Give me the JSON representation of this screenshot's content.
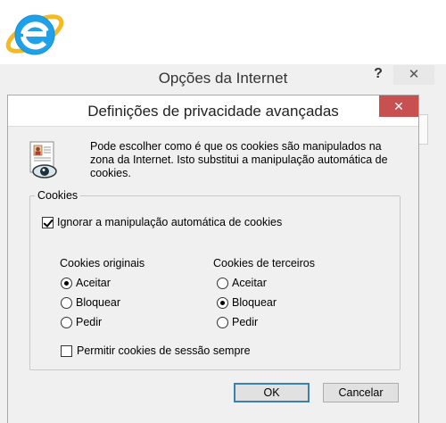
{
  "back_window": {
    "title": "Opções da Internet",
    "help_label": "?",
    "close_label": "✕"
  },
  "dialog": {
    "title": "Definições de privacidade avançadas",
    "close_label": "✕",
    "description": "Pode escolher como é que os cookies são manipulados na zona da Internet. Isto substitui a manipulação automática de cookies.",
    "group_label": "Cookies",
    "override_checkbox": {
      "label": "Ignorar a manipulação automática de cookies",
      "checked": true
    },
    "first_party": {
      "heading": "Cookies originais",
      "options": [
        {
          "label": "Aceitar",
          "selected": true
        },
        {
          "label": "Bloquear",
          "selected": false
        },
        {
          "label": "Pedir",
          "selected": false
        }
      ]
    },
    "third_party": {
      "heading": "Cookies de terceiros",
      "options": [
        {
          "label": "Aceitar",
          "selected": false
        },
        {
          "label": "Bloquear",
          "selected": true
        },
        {
          "label": "Pedir",
          "selected": false
        }
      ]
    },
    "session_checkbox": {
      "label": "Permitir cookies de sessão sempre",
      "checked": false
    },
    "ok_label": "OK",
    "cancel_label": "Cancelar"
  },
  "icons": {
    "logo": "internet-explorer-logo",
    "privacy": "privacy-document-icon"
  },
  "colors": {
    "close_button": "#c75050",
    "logo_blue": "#1ea1e8",
    "logo_ring": "#f5b921",
    "dialog_bg": "#f0f0f0"
  }
}
